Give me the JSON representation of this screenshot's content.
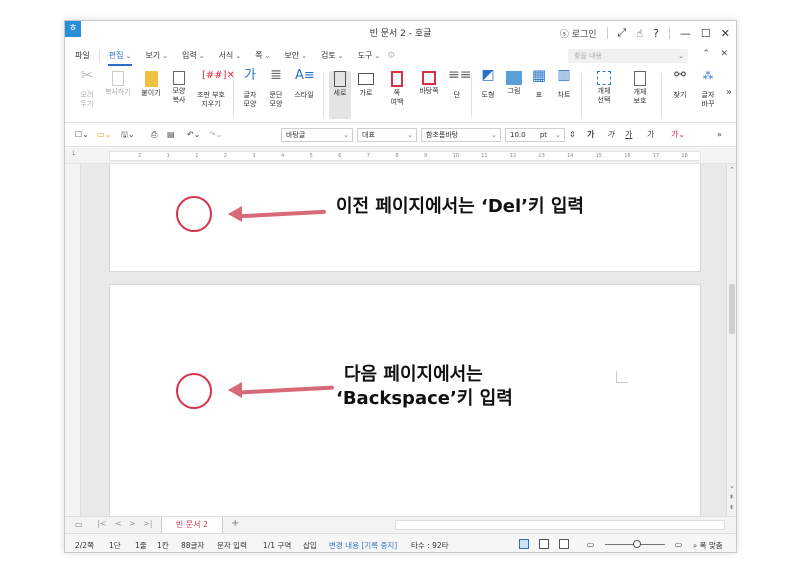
{
  "window": {
    "title": "빈 문서 2 - 호글",
    "login_label": "로그인",
    "help_label": "?"
  },
  "menu": {
    "items": [
      {
        "label": "파일",
        "active": false
      },
      {
        "label": "편집",
        "active": true
      },
      {
        "label": "보기",
        "active": false
      },
      {
        "label": "입력",
        "active": false
      },
      {
        "label": "서식",
        "active": false
      },
      {
        "label": "쪽",
        "active": false
      },
      {
        "label": "보안",
        "active": false
      },
      {
        "label": "검토",
        "active": false
      },
      {
        "label": "도구",
        "active": false
      }
    ],
    "search_placeholder": "찾을 내용"
  },
  "ribbon": {
    "buttons": [
      {
        "label": "오려\n두기",
        "icon": "scissors-icon",
        "disabled": true
      },
      {
        "label": "복사하기",
        "icon": "copy-icon",
        "disabled": true
      },
      {
        "label": "붙이기",
        "icon": "paste-icon",
        "disabled": false
      },
      {
        "label": "모양\n복사",
        "icon": "format-painter-icon",
        "disabled": false
      },
      {
        "label": "조판 부호\n지우기",
        "icon": "clear-codes-icon",
        "disabled": false
      },
      {
        "label": "글자\n모양",
        "icon": "char-shape-icon",
        "disabled": false
      },
      {
        "label": "문단\n모양",
        "icon": "para-shape-icon",
        "disabled": false
      },
      {
        "label": "스타일",
        "icon": "style-icon",
        "disabled": false
      },
      {
        "label": "세로",
        "icon": "portrait-icon",
        "disabled": false,
        "selected": true
      },
      {
        "label": "가로",
        "icon": "landscape-icon",
        "disabled": false
      },
      {
        "label": "쪽\n여백",
        "icon": "margin-icon",
        "disabled": false
      },
      {
        "label": "바탕쪽",
        "icon": "master-page-icon",
        "disabled": false
      },
      {
        "label": "단",
        "icon": "columns-icon",
        "disabled": false
      },
      {
        "label": "도형",
        "icon": "shape-icon",
        "disabled": false
      },
      {
        "label": "그림",
        "icon": "picture-icon",
        "disabled": false
      },
      {
        "label": "표",
        "icon": "table-icon",
        "disabled": false
      },
      {
        "label": "차트",
        "icon": "chart-icon",
        "disabled": false
      },
      {
        "label": "개체\n선택",
        "icon": "select-object-icon",
        "disabled": false
      },
      {
        "label": "개체\n보호",
        "icon": "protect-object-icon",
        "disabled": false
      },
      {
        "label": "찾기",
        "icon": "binoculars-icon",
        "disabled": false
      },
      {
        "label": "글자\n바꾸",
        "icon": "replace-icon",
        "disabled": false
      }
    ]
  },
  "toolbar": {
    "style_combo": "바탕글",
    "lang_combo": "대표",
    "font_combo": "함초롬바탕",
    "size_value": "10.0",
    "size_unit": "pt",
    "bold": "가",
    "italic": "가",
    "underline": "가",
    "strike": "가"
  },
  "ruler": {
    "ticks": [
      "2",
      "1",
      "1",
      "2",
      "3",
      "4",
      "5",
      "6",
      "7",
      "8",
      "9",
      "10",
      "11",
      "12",
      "13",
      "14",
      "15",
      "16",
      "17",
      "18"
    ]
  },
  "annotations": {
    "note1": "이전 페이지에서는 ‘Del’키 입력",
    "note2_line1": "다음 페이지에서는",
    "note2_line2": "‘Backspace’키 입력"
  },
  "tabs": {
    "doc_tab": "빈 문서 2",
    "add": "+"
  },
  "status": {
    "page": "2/2쪽",
    "section": "1단",
    "line": "1줄",
    "col": "1칸",
    "chars": "88글자",
    "mode": "문자 입력",
    "area": "1/1 구역",
    "insert": "삽입",
    "track": "변경 내용 [기록 중지]",
    "typing": "타수 : 92타",
    "zoom": "폭 맞춤"
  },
  "colors": {
    "accent": "#2a72c8",
    "annotation_red": "#d9304a",
    "arrow": "#d86a78"
  }
}
